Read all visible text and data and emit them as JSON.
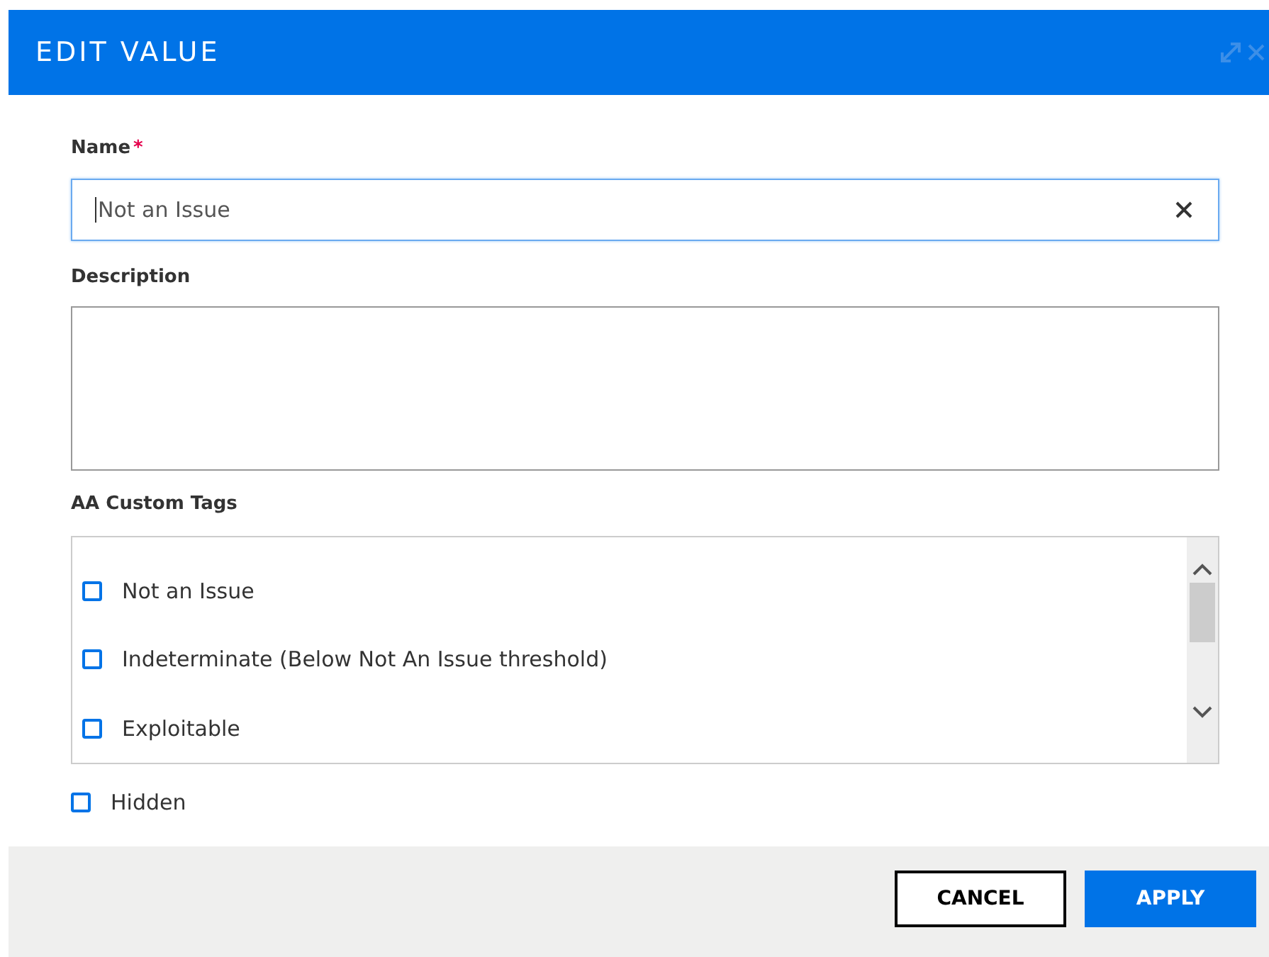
{
  "dialog": {
    "title": "EDIT VALUE"
  },
  "name_field": {
    "label": "Name",
    "required_mark": "*",
    "value": "Not an Issue"
  },
  "description_field": {
    "label": "Description"
  },
  "tags": {
    "label": "AA Custom Tags",
    "items": [
      {
        "label": "Not an Issue",
        "checked": false
      },
      {
        "label": "Indeterminate (Below Not An Issue threshold)",
        "checked": false
      },
      {
        "label": "Exploitable",
        "checked": false
      }
    ]
  },
  "hidden": {
    "label": "Hidden",
    "checked": false
  },
  "buttons": [
    {
      "label": "CANCEL",
      "kind": "secondary"
    },
    {
      "label": "APPLY",
      "kind": "primary"
    }
  ]
}
